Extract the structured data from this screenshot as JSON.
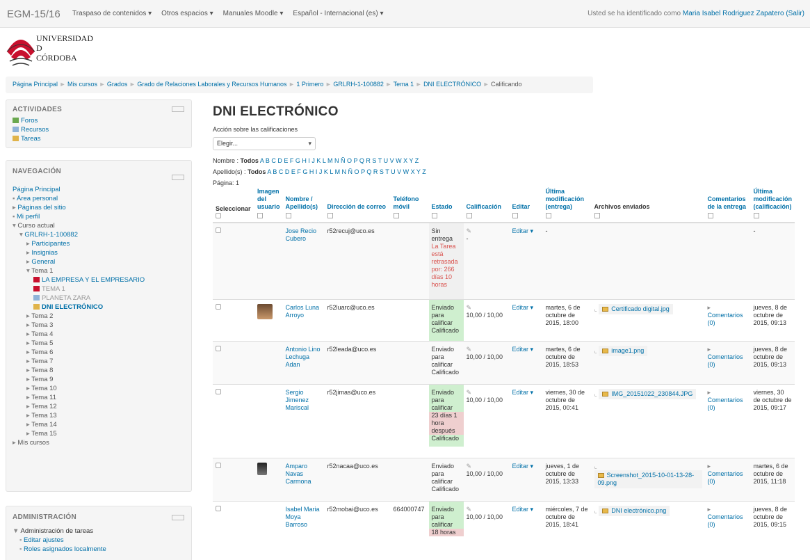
{
  "navbar": {
    "brand": "EGM-15/16",
    "menu": [
      "Traspaso de contenidos ▾",
      "Otros espacios ▾",
      "Manuales Moodle ▾",
      "Español - Internacional (es) ▾"
    ],
    "login_prefix": "Usted se ha identificado como ",
    "user": "Maria Isabel Rodriguez Zapatero",
    "logout": "(Salir)"
  },
  "logo": {
    "line1": "UNIVERSIDAD",
    "line2": "D",
    "line3": "CÓRDOBA"
  },
  "breadcrumb": [
    "Página Principal",
    "Mis cursos",
    "Grados",
    "Grado de Relaciones Laborales y Recursos Humanos",
    "1 Primero",
    "GRLRH-1-100882",
    "Tema 1",
    "DNI ELECTRÓNICO",
    "Calificando"
  ],
  "actividades": {
    "title": "ACTIVIDADES",
    "items": [
      "Foros",
      "Recursos",
      "Tareas"
    ]
  },
  "navegacion": {
    "title": "NAVEGACIÓN",
    "items": [
      "Página Principal",
      "Área personal",
      "Páginas del sitio",
      "Mi perfil",
      "Curso actual",
      "GRLRH-1-100882",
      "Participantes",
      "Insignias",
      "General",
      "Tema 1",
      "LA EMPRESA Y EL EMPRESARIO",
      "TEMA 1",
      "PLANETA ZARA",
      "DNI ELECTRÓNICO",
      "Tema 2",
      "Tema 3",
      "Tema 4",
      "Tema 5",
      "Tema 6",
      "Tema 7",
      "Tema 8",
      "Tema 9",
      "Tema 10",
      "Tema 11",
      "Tema 12",
      "Tema 13",
      "Tema 14",
      "Tema 15",
      "Mis cursos"
    ]
  },
  "administracion": {
    "title": "ADMINISTRACIÓN",
    "items": [
      "Administración de tareas",
      "Editar ajustes",
      "Roles asignados localmente"
    ]
  },
  "main": {
    "title": "DNI ELECTRÓNICO",
    "accion": "Acción sobre las calificaciones",
    "select": "Elegir...",
    "nombre_label": "Nombre : ",
    "apellido_label": "Apellido(s) : ",
    "todos": "Todos",
    "letters": "A B C D E F G H I J K L M N Ñ O P Q R S T U V W X Y Z",
    "pagina": "Página:  1"
  },
  "headers": [
    "Seleccionar",
    "Imagen del usuario",
    "Nombre / Apellido(s)",
    "Dirección de correo",
    "Teléfono móvil",
    "Estado",
    "Calificación",
    "Editar",
    "Última modificación (entrega)",
    "Archivos enviados",
    "Comentarios de la entrega",
    "Última modificación (calificación)"
  ],
  "rows": [
    {
      "name": "Jose Recio Cubero",
      "email": "r52recuj@uco.es",
      "phone": "",
      "estado": "Sin entrega",
      "late": "La Tarea está retrasada por: 266 días 10 horas",
      "calif": "-",
      "edit": "Editar ▾",
      "mod": "-",
      "file": "",
      "com": "",
      "modc": "-"
    },
    {
      "name": "Carlos Luna Arroyo",
      "email": "r52luarc@uco.es",
      "phone": "",
      "estado": "Enviado para calificar Calificado",
      "late": "",
      "calif": "10,00 / 10,00",
      "edit": "Editar ▾",
      "mod": "martes, 6 de octubre de 2015, 18:00",
      "file": "Certificado digital.jpg",
      "com": "Comentarios (0)",
      "modc": "jueves, 8 de octubre de 2015, 09:13"
    },
    {
      "name": "Antonio Lino Lechuga Adan",
      "email": "r52leada@uco.es",
      "phone": "",
      "estado": "Enviado para calificar Calificado",
      "late": "",
      "calif": "10,00 / 10,00",
      "edit": "Editar ▾",
      "mod": "martes, 6 de octubre de 2015, 18:53",
      "file": "image1.png",
      "com": "Comentarios (0)",
      "modc": "jueves, 8 de octubre de 2015, 09:13"
    },
    {
      "name": "Sergio Jimenez Mariscal",
      "email": "r52jimas@uco.es",
      "phone": "",
      "estado": "Enviado para calificar",
      "late": "23 días 1 hora después",
      "estado2": "Calificado",
      "calif": "10,00 / 10,00",
      "edit": "Editar ▾",
      "mod": "viernes, 30 de octubre de 2015, 00:41",
      "file": "IMG_20151022_230844.JPG",
      "com": "Comentarios (0)",
      "modc": "viernes, 30 de octubre de 2015, 09:17"
    },
    {
      "name": "Amparo Navas Carmona",
      "email": "r52nacaa@uco.es",
      "phone": "",
      "estado": "Enviado para calificar Calificado",
      "late": "",
      "calif": "10,00 / 10,00",
      "edit": "Editar ▾",
      "mod": "jueves, 1 de octubre de 2015, 13:33",
      "file": "Screenshot_2015-10-01-13-28-09.png",
      "com": "Comentarios (0)",
      "modc": "martes, 6 de octubre de 2015, 11:18"
    },
    {
      "name": "Isabel Maria Moya Barroso",
      "email": "r52mobai@uco.es",
      "phone": "664000747",
      "estado": "Enviado para calificar",
      "late": "18 horas",
      "calif": "10,00 / 10,00",
      "edit": "Editar ▾",
      "mod": "miércoles, 7 de octubre de 2015, 18:41",
      "file": "DNI electrónico.png",
      "com": "Comentarios (0)",
      "modc": "jueves, 8 de octubre de 2015, 09:15"
    }
  ]
}
